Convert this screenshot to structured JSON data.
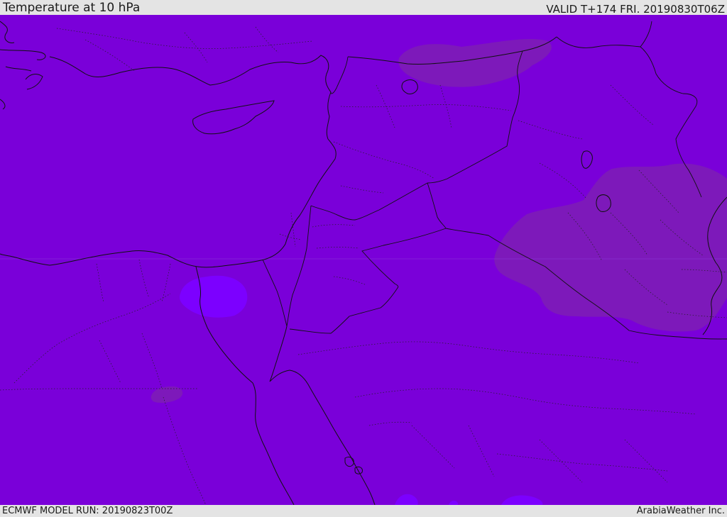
{
  "header": {
    "title": "Temperature at 10 hPa",
    "valid": "VALID T+174 FRI. 20190830T06Z"
  },
  "footer": {
    "model_run": "ECMWF MODEL RUN: 20190823T00Z",
    "brand": "ArabiaWeather Inc."
  },
  "map": {
    "base_fill_color": "#7a00d9",
    "warm_patch_color": "#7d1ab8",
    "cool_patch_color": "#7c00ff",
    "coastline_color": "#111111",
    "border_style": "solid",
    "subdivision_style": "dotted"
  }
}
